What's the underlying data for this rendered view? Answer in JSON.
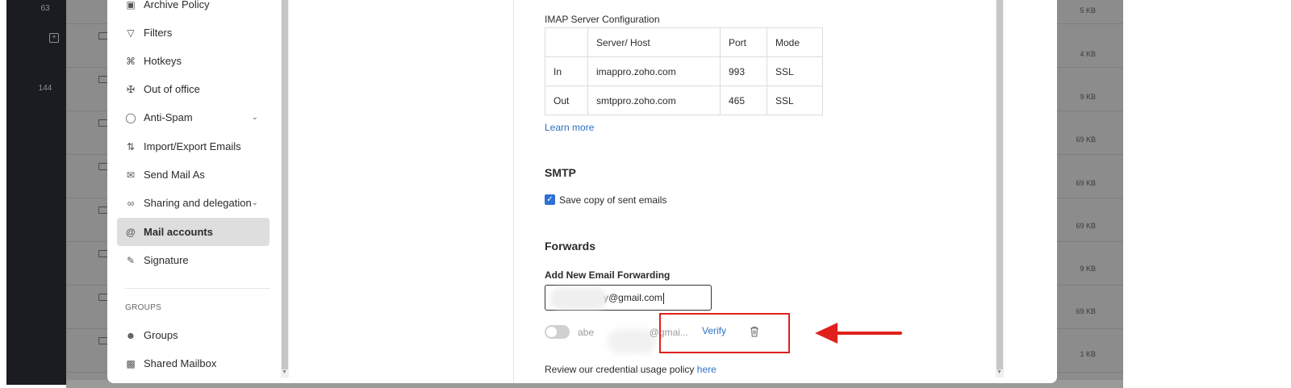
{
  "rail": {
    "counts": [
      "63",
      "144"
    ]
  },
  "mail_list": {
    "sizes": [
      "5 KB",
      "4 KB",
      "9 KB",
      "69 KB",
      "69 KB",
      "69 KB",
      "9 KB",
      "69 KB",
      "1 KB"
    ]
  },
  "sidebar": {
    "items": [
      {
        "label": "Archive Policy",
        "icon": "archive-icon"
      },
      {
        "label": "Filters",
        "icon": "filter-icon"
      },
      {
        "label": "Hotkeys",
        "icon": "command-icon"
      },
      {
        "label": "Out of office",
        "icon": "plane-icon"
      },
      {
        "label": "Anti-Spam",
        "icon": "shield-icon",
        "expandable": true
      },
      {
        "label": "Import/Export Emails",
        "icon": "import-export-icon"
      },
      {
        "label": "Send Mail As",
        "icon": "send-as-icon"
      },
      {
        "label": "Sharing and delegation",
        "icon": "share-icon",
        "expandable": true
      },
      {
        "label": "Mail accounts",
        "icon": "at-icon",
        "active": true
      },
      {
        "label": "Signature",
        "icon": "signature-icon"
      }
    ],
    "group_heading": "GROUPS",
    "group_items": [
      {
        "label": "Groups",
        "icon": "groups-icon"
      },
      {
        "label": "Shared Mailbox",
        "icon": "shared-mailbox-icon"
      }
    ]
  },
  "imap": {
    "title": "IMAP Server Configuration",
    "headers": [
      "",
      "Server/ Host",
      "Port",
      "Mode"
    ],
    "rows": [
      [
        "In",
        "imappro.zoho.com",
        "993",
        "SSL"
      ],
      [
        "Out",
        "smtppro.zoho.com",
        "465",
        "SSL"
      ]
    ],
    "learn_more": "Learn more"
  },
  "smtp": {
    "title": "SMTP",
    "save_copy_label": "Save copy of sent emails",
    "save_copy_checked": true
  },
  "forwards": {
    "title": "Forwards",
    "add_label": "Add New Email Forwarding",
    "input_value": "y@gmail.com",
    "entry_prefix": "abe",
    "entry_suffix": "@gmai...",
    "entry_enabled": false,
    "verify_label": "Verify"
  },
  "policy": {
    "text": "Review our credential usage policy",
    "link": "here"
  },
  "colors": {
    "accent": "#2d6fc4",
    "highlight": "#e0201c",
    "checkbox": "#2f6fd6",
    "active_nav": "#dedede"
  }
}
